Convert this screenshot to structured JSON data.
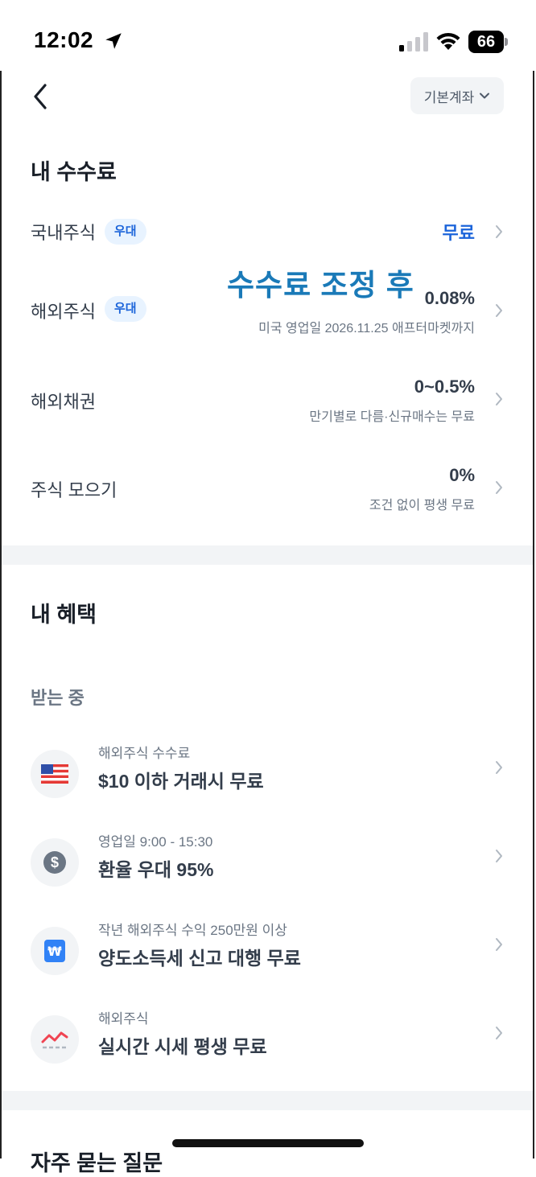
{
  "status_bar": {
    "time": "12:02",
    "battery": "66"
  },
  "header": {
    "account_label": "기본계좌"
  },
  "fees": {
    "title": "내 수수료",
    "rows": [
      {
        "label": "국내주식",
        "badge": "우대",
        "value": "무료",
        "sub": ""
      },
      {
        "label": "해외주식",
        "badge": "우대",
        "value": "0.08%",
        "sub": "미국 영업일 2026.11.25 애프터마켓까지"
      },
      {
        "label": "해외채권",
        "badge": "",
        "value": "0~0.5%",
        "sub": "만기별로 다름·신규매수는 무료"
      },
      {
        "label": "주식 모으기",
        "badge": "",
        "value": "0%",
        "sub": "조건 없이 평생 무료"
      }
    ],
    "overlay_note": "수수료 조정 후"
  },
  "benefits": {
    "title": "내 혜택",
    "subsection": "받는 중",
    "items": [
      {
        "icon": "us-flag-icon",
        "sub": "해외주식 수수료",
        "title": "$10 이하 거래시 무료"
      },
      {
        "icon": "dollar-coin-icon",
        "sub": "영업일 9:00 - 15:30",
        "title": "환율 우대 95%"
      },
      {
        "icon": "won-document-icon",
        "sub": "작년 해외주식 수익 250만원 이상",
        "title": "양도소득세 신고 대행 무료"
      },
      {
        "icon": "chart-line-icon",
        "sub": "해외주식",
        "title": "실시간 시세 평생 무료"
      }
    ]
  },
  "faq": {
    "title": "자주 묻는 질문"
  },
  "colors": {
    "accent": "#1b64da",
    "badge_bg": "#e8f3ff",
    "overlay": "#1a7ab8",
    "divider": "#f2f4f6"
  }
}
